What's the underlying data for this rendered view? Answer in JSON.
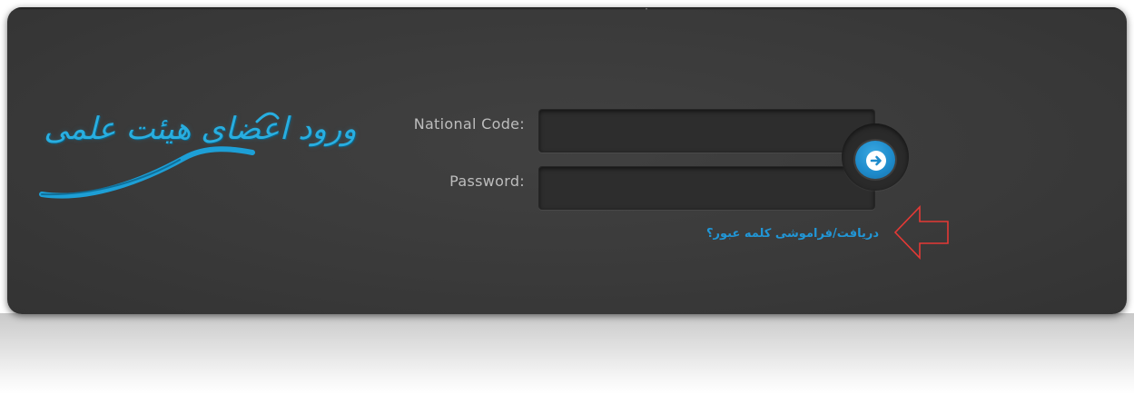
{
  "logo": {
    "title": "ورود اعضای هیئت علمی",
    "accent_color": "#28aee0"
  },
  "form": {
    "national_code_label": "National Code:",
    "national_code_value": "",
    "password_label": "Password:",
    "password_value": "",
    "submit_icon": "arrow-right-circle-icon",
    "submit_color": "#1f8ccc",
    "forgot_link": "دریافت/فراموشی کلمه عبور؟",
    "forgot_color": "#2196d6"
  },
  "annotation": {
    "icon": "left-arrow-outline-icon",
    "color": "#e53935"
  },
  "colors": {
    "panel": "#3a3a3a",
    "label": "#bdbdbd"
  }
}
